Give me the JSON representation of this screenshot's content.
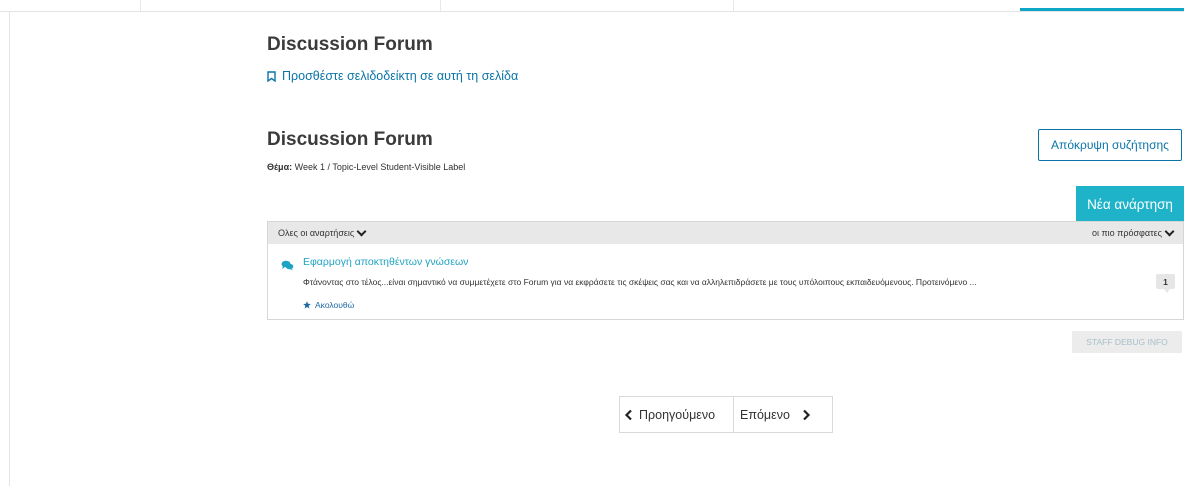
{
  "page": {
    "title": "Discussion Forum",
    "bookmark_label": "Προσθέστε σελιδοδείκτη σε αυτή τη σελίδα"
  },
  "forum": {
    "title": "Discussion Forum",
    "topic_label": "Θέμα:",
    "topic_value": "Week 1 / Topic-Level Student-Visible Label",
    "hide_discussion_label": "Απόκρυψη συζήτησης",
    "new_post_label": "Νέα ανάρτηση"
  },
  "threads": {
    "filter_label": "Ολες οι αναρτήσεις",
    "sort_label": "οι πιο πρόσφατες",
    "items": [
      {
        "title": "Εφαρμογή αποκτηθέντων γνώσεων",
        "excerpt": "Φτάνοντας στο τέλος...είναι σημαντικό να συμμετέχετε στο Forum για να εκφράσετε τις σκέψεις σας και να αλληλεπιδράσετε με τους υπόλοιπους εκπαιδευόμενους. Προτεινόμενο ...",
        "follow_label": "Ακολουθώ",
        "count": "1"
      }
    ]
  },
  "debug_label": "STAFF DEBUG INFO",
  "pager": {
    "prev_label": "Προηγούμενο",
    "next_label": "Επόμενο"
  },
  "colors": {
    "accent": "#1fb3c9",
    "link": "#0a74a8"
  }
}
